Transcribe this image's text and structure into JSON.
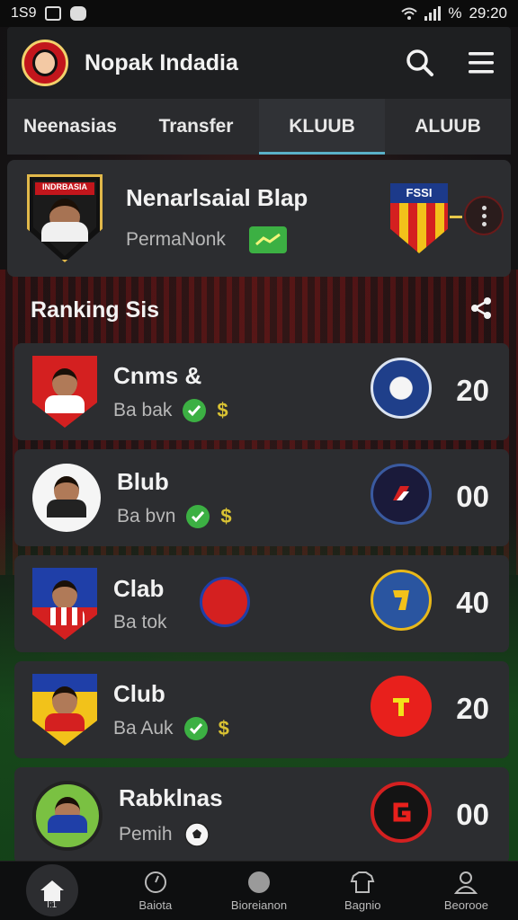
{
  "status_bar": {
    "left_text": "1S9",
    "battery_text": "%",
    "time": "29:20"
  },
  "header": {
    "title": "Nopak Indadia"
  },
  "tabs": [
    {
      "label": "Neenasias",
      "active": false
    },
    {
      "label": "Transfer",
      "active": false
    },
    {
      "label": "KLUUB",
      "active": true
    },
    {
      "label": "ALUUB",
      "active": false
    }
  ],
  "profile": {
    "crest_text": "INDRBASIA",
    "name": "Nenarlsaial Blap",
    "sub": "PermaNonk",
    "club_crest_text": "FSSI"
  },
  "section": {
    "title": "Ranking Sis"
  },
  "rows": [
    {
      "name": "Cnms &",
      "sub": "Ba bak",
      "score": "20",
      "currency": "$"
    },
    {
      "name": "Blub",
      "sub": "Ba bvn",
      "score": "00",
      "currency": "$"
    },
    {
      "name": "Clab",
      "sub": "Ba tok",
      "score": "40",
      "currency": "$"
    },
    {
      "name": "Club",
      "sub": "Ba Auk",
      "score": "20",
      "currency": "$"
    },
    {
      "name": "Rabklnas",
      "sub": "Pemih",
      "score": "00",
      "currency": ""
    }
  ],
  "bottom_nav": [
    {
      "label": "Ⅰ:1",
      "icon": "home-icon",
      "active": true
    },
    {
      "label": "Baiota",
      "icon": "timer-icon",
      "active": false
    },
    {
      "label": "Bioreianon",
      "icon": "ball-icon",
      "active": false
    },
    {
      "label": "Bagnio",
      "icon": "shirt-icon",
      "active": false
    },
    {
      "label": "Beorooe",
      "icon": "profile-icon",
      "active": false
    }
  ],
  "colors": {
    "accent": "#5ab0c8",
    "positive": "#3cb043",
    "brand_red": "#c2161c"
  }
}
